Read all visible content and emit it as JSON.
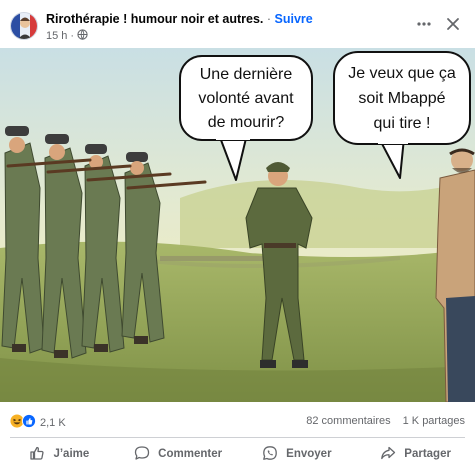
{
  "post": {
    "page_name": "Rirothérapie ! humour noir et autres.",
    "separator": " · ",
    "follow_label": "Suivre",
    "time": "15 h",
    "time_separator": "·",
    "audience_icon": "globe-icon",
    "more_icon": "more-options-icon",
    "close_icon": "close-icon"
  },
  "meme": {
    "bubble_left": [
      "Une dernière",
      "volonté avant",
      "de mourir?"
    ],
    "bubble_right": [
      "Je veux que ça",
      "soit Mbappé",
      "qui tire !"
    ]
  },
  "stats": {
    "reaction_icons": [
      "haha-icon",
      "like-icon"
    ],
    "reactions_count": "2,1 K",
    "comments": "82 commentaires",
    "shares": "1 K partages"
  },
  "actions": {
    "like": "J’aime",
    "comment": "Commenter",
    "send": "Envoyer",
    "share": "Partager"
  },
  "colors": {
    "accent": "#0866ff",
    "secondary_text": "#65676b"
  }
}
